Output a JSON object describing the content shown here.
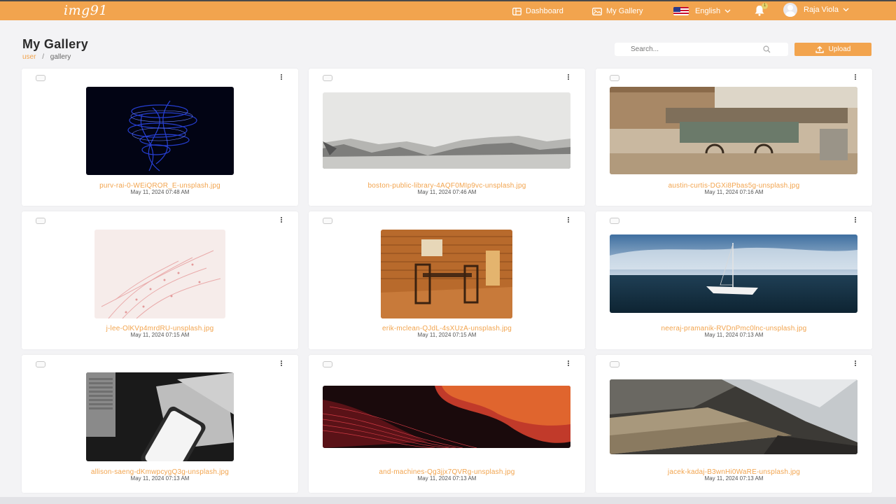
{
  "app": {
    "logo": "img91"
  },
  "nav": {
    "dashboard": "Dashboard",
    "gallery": "My Gallery",
    "language": "English",
    "notifications_count": "1",
    "user_name": "Raja Viola"
  },
  "header": {
    "title": "My Gallery",
    "breadcrumb": [
      "user",
      "gallery"
    ]
  },
  "search": {
    "placeholder": "Search..."
  },
  "upload": {
    "label": "Upload"
  },
  "colors": {
    "accent": "#f2a44e",
    "background": "#f3f3f5"
  },
  "gallery": [
    {
      "name": "purv-rai-0-WEiQROR_E-unsplash.jpg",
      "date": "May 11, 2024 07:48 AM"
    },
    {
      "name": "boston-public-library-4AQF0MIp9vc-unsplash.jpg",
      "date": "May 11, 2024 07:46 AM"
    },
    {
      "name": "austin-curtis-DGXi8Pbas5g-unsplash.jpg",
      "date": "May 11, 2024 07:16 AM"
    },
    {
      "name": "j-lee-OlKVp4mrdRU-unsplash.jpg",
      "date": "May 11, 2024 07:15 AM"
    },
    {
      "name": "erik-mclean-QJdL-4sXUzA-unsplash.jpg",
      "date": "May 11, 2024 07:15 AM"
    },
    {
      "name": "neeraj-pramanik-RVDnPmc0lnc-unsplash.jpg",
      "date": "May 11, 2024 07:13 AM"
    },
    {
      "name": "allison-saeng-dKmwpcygQ3g-unsplash.jpg",
      "date": "May 11, 2024 07:13 AM"
    },
    {
      "name": "and-machines-Qg3jjx7QVRg-unsplash.jpg",
      "date": "May 11, 2024 07:13 AM"
    },
    {
      "name": "jacek-kadaj-B3wnHi0WaRE-unsplash.jpg",
      "date": "May 11, 2024 07:13 AM"
    }
  ]
}
